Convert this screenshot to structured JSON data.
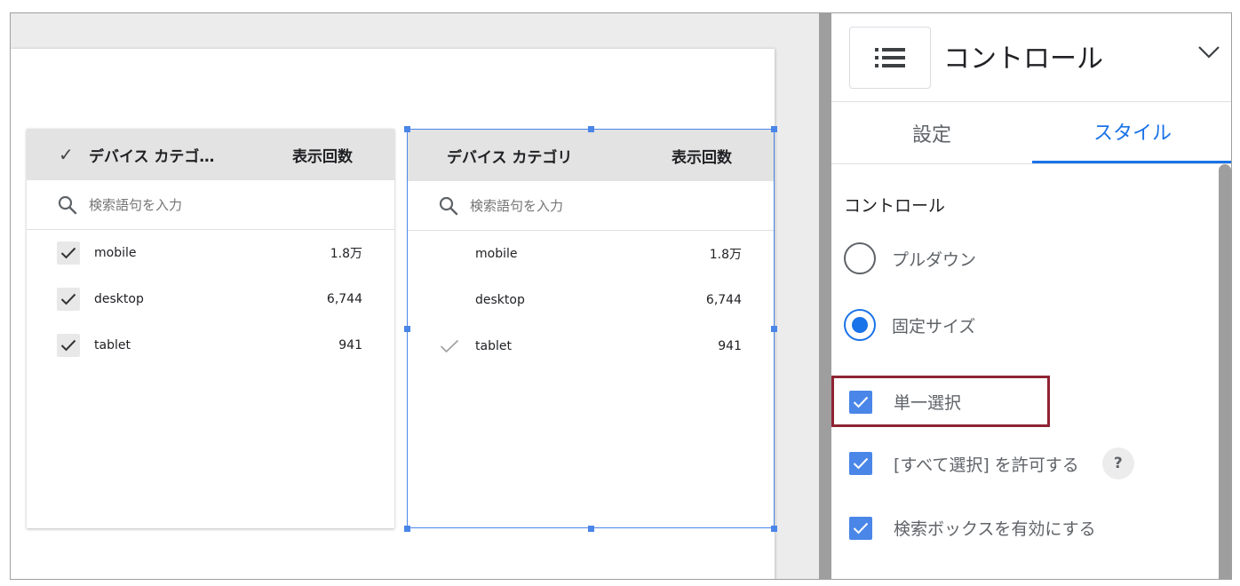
{
  "left_widget": {
    "header_dimension": "デバイス カテゴ…",
    "header_metric": "表示回数",
    "search_placeholder": "検索語句を入力",
    "rows": [
      {
        "name": "mobile",
        "value": "1.8万"
      },
      {
        "name": "desktop",
        "value": "6,744"
      },
      {
        "name": "tablet",
        "value": "941"
      }
    ]
  },
  "right_widget": {
    "header_dimension": "デバイス カテゴリ",
    "header_metric": "表示回数",
    "search_placeholder": "検索語句を入力",
    "rows": [
      {
        "name": "mobile",
        "value": "1.8万"
      },
      {
        "name": "desktop",
        "value": "6,744"
      },
      {
        "name": "tablet",
        "value": "941"
      }
    ]
  },
  "panel": {
    "title": "コントロール",
    "tabs": [
      {
        "label": "設定"
      },
      {
        "label": "スタイル"
      }
    ],
    "section_title": "コントロール",
    "radio_options": [
      {
        "label": "プルダウン",
        "selected": false
      },
      {
        "label": "固定サイズ",
        "selected": true
      }
    ],
    "checkboxes": [
      {
        "label": "単一選択",
        "checked": true
      },
      {
        "label": "[すべて選択] を許可する",
        "checked": true
      },
      {
        "label": "検索ボックスを有効にする",
        "checked": true
      }
    ],
    "help_label": "?"
  },
  "colors": {
    "accent": "#1a73e8",
    "checkbox": "#4a86e8",
    "highlight_border": "#8e2433"
  },
  "icons": [
    "list-icon",
    "chevron-down-icon",
    "search-icon",
    "check-icon",
    "help-icon"
  ]
}
